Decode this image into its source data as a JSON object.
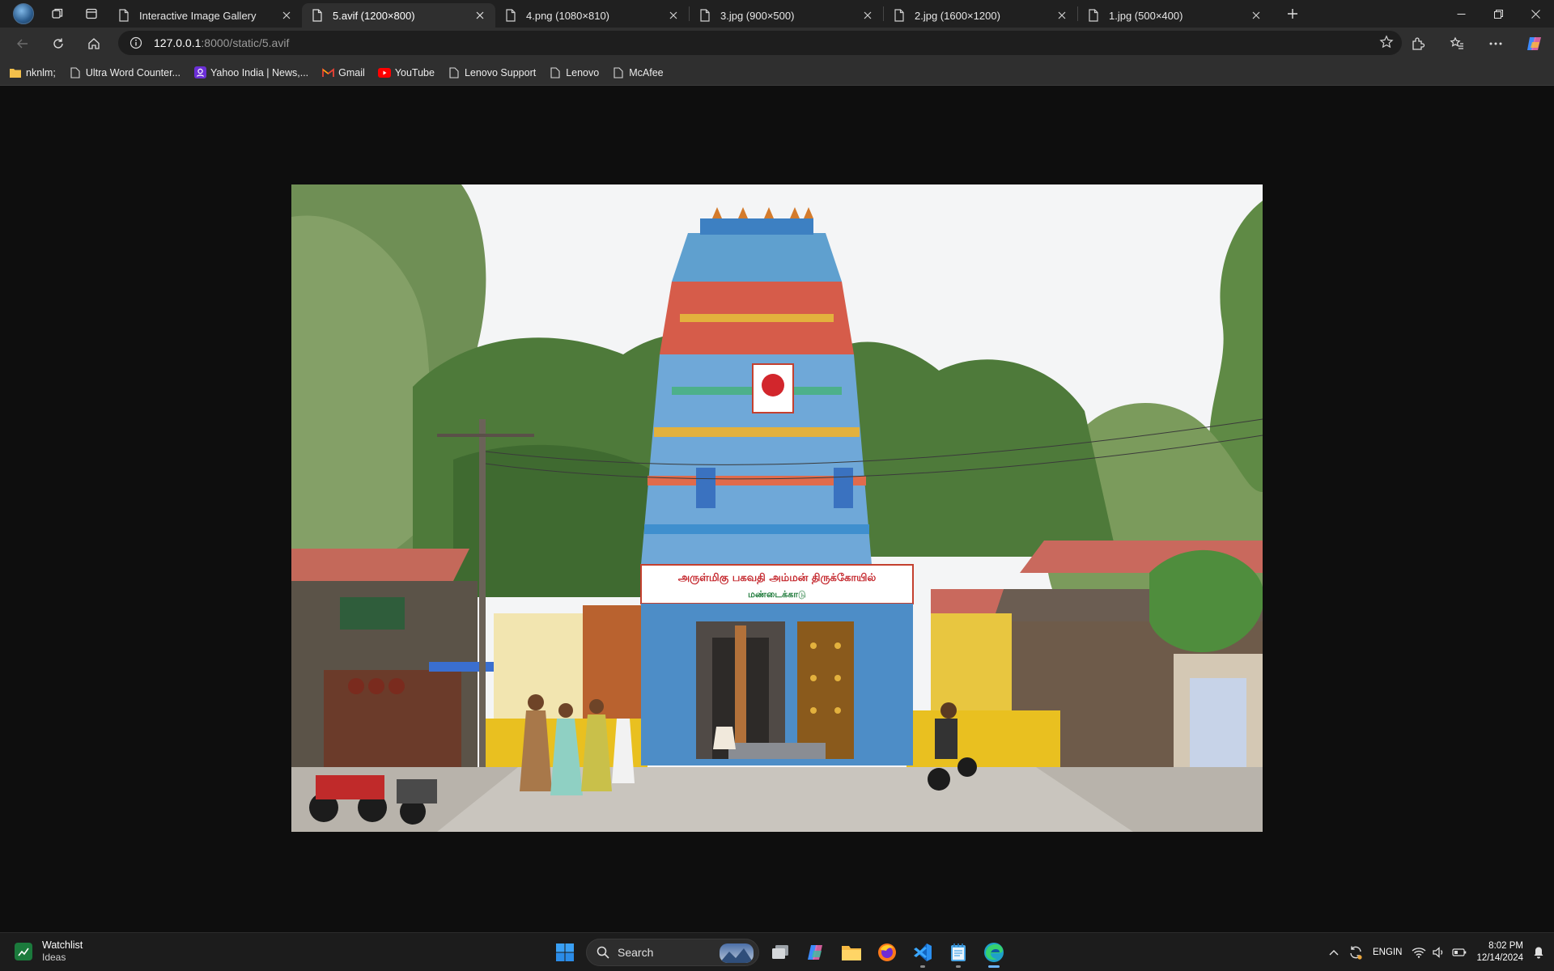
{
  "browser": {
    "tabs": [
      {
        "title": "Interactive Image Gallery",
        "active": false
      },
      {
        "title": "5.avif (1200×800)",
        "active": true
      },
      {
        "title": "4.png (1080×810)",
        "active": false
      },
      {
        "title": "3.jpg (900×500)",
        "active": false
      },
      {
        "title": "2.jpg (1600×1200)",
        "active": false
      },
      {
        "title": "1.jpg (500×400)",
        "active": false
      }
    ],
    "address": {
      "host": "127.0.0.1",
      "rest": ":8000/static/5.avif"
    },
    "bookmarks": [
      {
        "label": "nknlm;",
        "icon": "folder-icon"
      },
      {
        "label": "Ultra Word Counter...",
        "icon": "page-icon"
      },
      {
        "label": "Yahoo India | News,...",
        "icon": "yahoo-icon"
      },
      {
        "label": "Gmail",
        "icon": "gmail-icon"
      },
      {
        "label": "YouTube",
        "icon": "youtube-icon"
      },
      {
        "label": "Lenovo Support",
        "icon": "page-icon"
      },
      {
        "label": "Lenovo",
        "icon": "page-icon"
      },
      {
        "label": "McAfee",
        "icon": "page-icon"
      }
    ]
  },
  "image": {
    "signboard_line1": "அருள்மிகு பகவதி அம்மன் திருக்கோயில்",
    "signboard_line2": "மண்டைக்காடு"
  },
  "taskbar": {
    "widget_title": "Watchlist",
    "widget_subtitle": "Ideas",
    "search_label": "Search",
    "language": "ENG",
    "region": "IN",
    "time": "8:02 PM",
    "date": "12/14/2024"
  },
  "colors": {
    "tab_strip": "#202020",
    "toolbar": "#2f2f2f",
    "page_background": "#0e0e0e",
    "taskbar": "#1c1c1c",
    "accent": "#6cb6ff"
  }
}
